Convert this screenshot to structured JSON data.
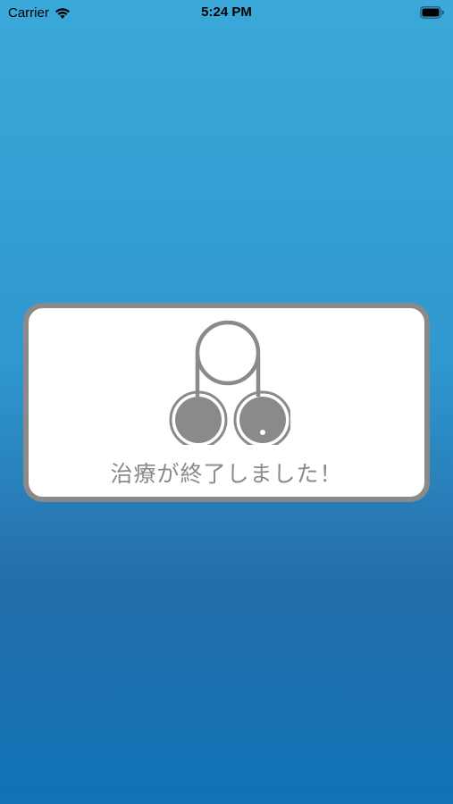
{
  "status_bar": {
    "carrier": "Carrier",
    "time": "5:24 PM",
    "wifi_icon": "wifi-icon",
    "battery_icon": "battery-icon"
  },
  "dialog": {
    "icon": "treatment-device-icon",
    "message": "治療が終了しました！"
  },
  "colors": {
    "background_top": "#3aa8d8",
    "background_bottom": "#0f73b6",
    "card_border": "#8a8a8a",
    "card_background": "#ffffff",
    "message_text": "#8a8a8a"
  }
}
